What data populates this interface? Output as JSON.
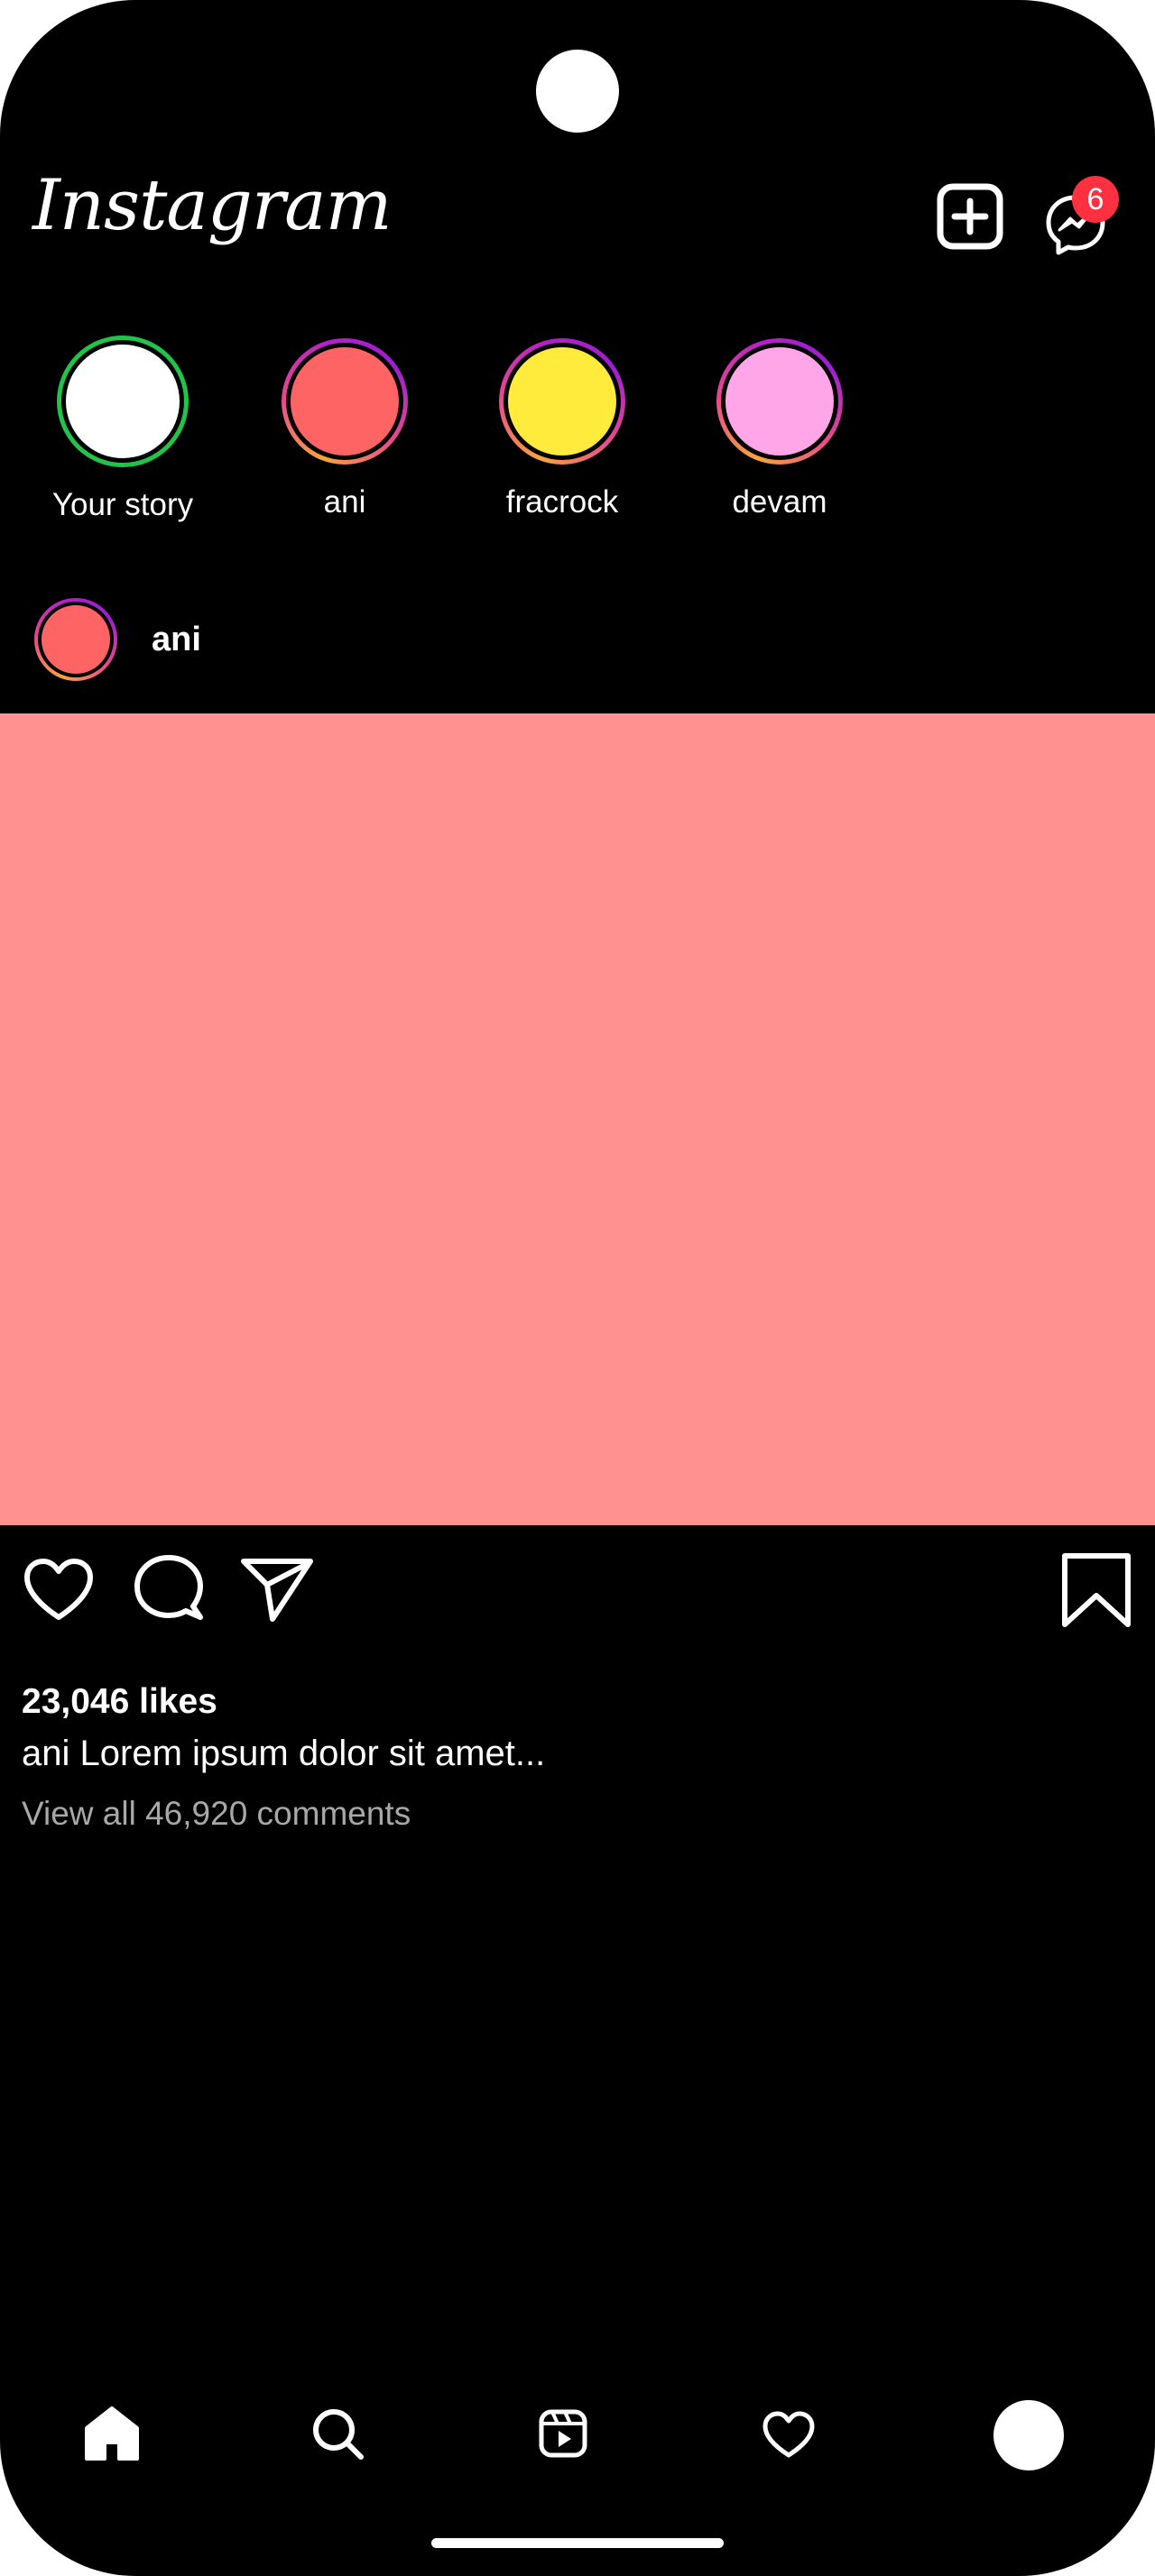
{
  "header": {
    "logo_text": "Instagram",
    "add_icon": "plus-square-icon",
    "messenger_icon": "messenger-icon",
    "messenger_badge_count": "6",
    "badge_color": "#ff3040"
  },
  "stories": [
    {
      "label": "Your story",
      "avatar_color": "#ffffff",
      "ring": "own"
    },
    {
      "label": "ani",
      "avatar_color": "#ff6464",
      "ring": "gradient"
    },
    {
      "label": "fracrock",
      "avatar_color": "#ffeb3b",
      "ring": "gradient"
    },
    {
      "label": "devam",
      "avatar_color": "#ffa6e8",
      "ring": "gradient"
    }
  ],
  "post": {
    "username": "ani",
    "avatar_color": "#ff6464",
    "image_color": "#ff9290",
    "likes": "23,046 likes",
    "caption_user": "ani",
    "caption_text": "Lorem ipsum dolor sit amet...",
    "comments_link": "View all 46,920 comments",
    "actions": [
      "heart-icon",
      "comment-icon",
      "share-icon",
      "bookmark-icon"
    ]
  },
  "bottom_nav": {
    "items": [
      "home-icon",
      "search-icon",
      "reels-icon",
      "activity-heart-icon",
      "profile-avatar"
    ],
    "active": "home-icon"
  }
}
